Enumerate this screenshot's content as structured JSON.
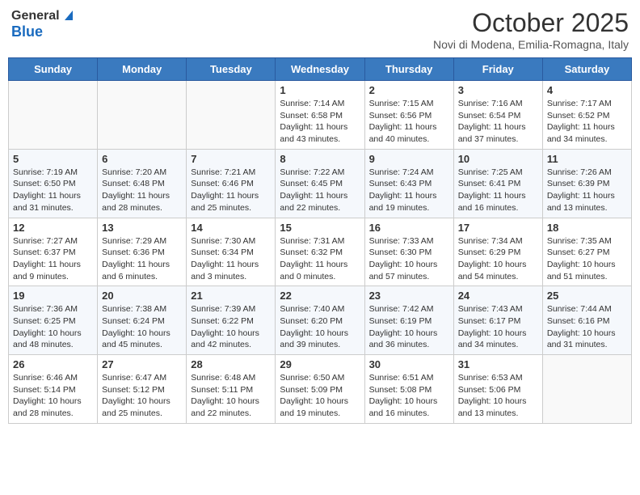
{
  "header": {
    "logo_general": "General",
    "logo_blue": "Blue",
    "month": "October 2025",
    "location": "Novi di Modena, Emilia-Romagna, Italy"
  },
  "weekdays": [
    "Sunday",
    "Monday",
    "Tuesday",
    "Wednesday",
    "Thursday",
    "Friday",
    "Saturday"
  ],
  "weeks": [
    [
      {
        "day": "",
        "info": ""
      },
      {
        "day": "",
        "info": ""
      },
      {
        "day": "",
        "info": ""
      },
      {
        "day": "1",
        "info": "Sunrise: 7:14 AM\nSunset: 6:58 PM\nDaylight: 11 hours and 43 minutes."
      },
      {
        "day": "2",
        "info": "Sunrise: 7:15 AM\nSunset: 6:56 PM\nDaylight: 11 hours and 40 minutes."
      },
      {
        "day": "3",
        "info": "Sunrise: 7:16 AM\nSunset: 6:54 PM\nDaylight: 11 hours and 37 minutes."
      },
      {
        "day": "4",
        "info": "Sunrise: 7:17 AM\nSunset: 6:52 PM\nDaylight: 11 hours and 34 minutes."
      }
    ],
    [
      {
        "day": "5",
        "info": "Sunrise: 7:19 AM\nSunset: 6:50 PM\nDaylight: 11 hours and 31 minutes."
      },
      {
        "day": "6",
        "info": "Sunrise: 7:20 AM\nSunset: 6:48 PM\nDaylight: 11 hours and 28 minutes."
      },
      {
        "day": "7",
        "info": "Sunrise: 7:21 AM\nSunset: 6:46 PM\nDaylight: 11 hours and 25 minutes."
      },
      {
        "day": "8",
        "info": "Sunrise: 7:22 AM\nSunset: 6:45 PM\nDaylight: 11 hours and 22 minutes."
      },
      {
        "day": "9",
        "info": "Sunrise: 7:24 AM\nSunset: 6:43 PM\nDaylight: 11 hours and 19 minutes."
      },
      {
        "day": "10",
        "info": "Sunrise: 7:25 AM\nSunset: 6:41 PM\nDaylight: 11 hours and 16 minutes."
      },
      {
        "day": "11",
        "info": "Sunrise: 7:26 AM\nSunset: 6:39 PM\nDaylight: 11 hours and 13 minutes."
      }
    ],
    [
      {
        "day": "12",
        "info": "Sunrise: 7:27 AM\nSunset: 6:37 PM\nDaylight: 11 hours and 9 minutes."
      },
      {
        "day": "13",
        "info": "Sunrise: 7:29 AM\nSunset: 6:36 PM\nDaylight: 11 hours and 6 minutes."
      },
      {
        "day": "14",
        "info": "Sunrise: 7:30 AM\nSunset: 6:34 PM\nDaylight: 11 hours and 3 minutes."
      },
      {
        "day": "15",
        "info": "Sunrise: 7:31 AM\nSunset: 6:32 PM\nDaylight: 11 hours and 0 minutes."
      },
      {
        "day": "16",
        "info": "Sunrise: 7:33 AM\nSunset: 6:30 PM\nDaylight: 10 hours and 57 minutes."
      },
      {
        "day": "17",
        "info": "Sunrise: 7:34 AM\nSunset: 6:29 PM\nDaylight: 10 hours and 54 minutes."
      },
      {
        "day": "18",
        "info": "Sunrise: 7:35 AM\nSunset: 6:27 PM\nDaylight: 10 hours and 51 minutes."
      }
    ],
    [
      {
        "day": "19",
        "info": "Sunrise: 7:36 AM\nSunset: 6:25 PM\nDaylight: 10 hours and 48 minutes."
      },
      {
        "day": "20",
        "info": "Sunrise: 7:38 AM\nSunset: 6:24 PM\nDaylight: 10 hours and 45 minutes."
      },
      {
        "day": "21",
        "info": "Sunrise: 7:39 AM\nSunset: 6:22 PM\nDaylight: 10 hours and 42 minutes."
      },
      {
        "day": "22",
        "info": "Sunrise: 7:40 AM\nSunset: 6:20 PM\nDaylight: 10 hours and 39 minutes."
      },
      {
        "day": "23",
        "info": "Sunrise: 7:42 AM\nSunset: 6:19 PM\nDaylight: 10 hours and 36 minutes."
      },
      {
        "day": "24",
        "info": "Sunrise: 7:43 AM\nSunset: 6:17 PM\nDaylight: 10 hours and 34 minutes."
      },
      {
        "day": "25",
        "info": "Sunrise: 7:44 AM\nSunset: 6:16 PM\nDaylight: 10 hours and 31 minutes."
      }
    ],
    [
      {
        "day": "26",
        "info": "Sunrise: 6:46 AM\nSunset: 5:14 PM\nDaylight: 10 hours and 28 minutes."
      },
      {
        "day": "27",
        "info": "Sunrise: 6:47 AM\nSunset: 5:12 PM\nDaylight: 10 hours and 25 minutes."
      },
      {
        "day": "28",
        "info": "Sunrise: 6:48 AM\nSunset: 5:11 PM\nDaylight: 10 hours and 22 minutes."
      },
      {
        "day": "29",
        "info": "Sunrise: 6:50 AM\nSunset: 5:09 PM\nDaylight: 10 hours and 19 minutes."
      },
      {
        "day": "30",
        "info": "Sunrise: 6:51 AM\nSunset: 5:08 PM\nDaylight: 10 hours and 16 minutes."
      },
      {
        "day": "31",
        "info": "Sunrise: 6:53 AM\nSunset: 5:06 PM\nDaylight: 10 hours and 13 minutes."
      },
      {
        "day": "",
        "info": ""
      }
    ]
  ]
}
